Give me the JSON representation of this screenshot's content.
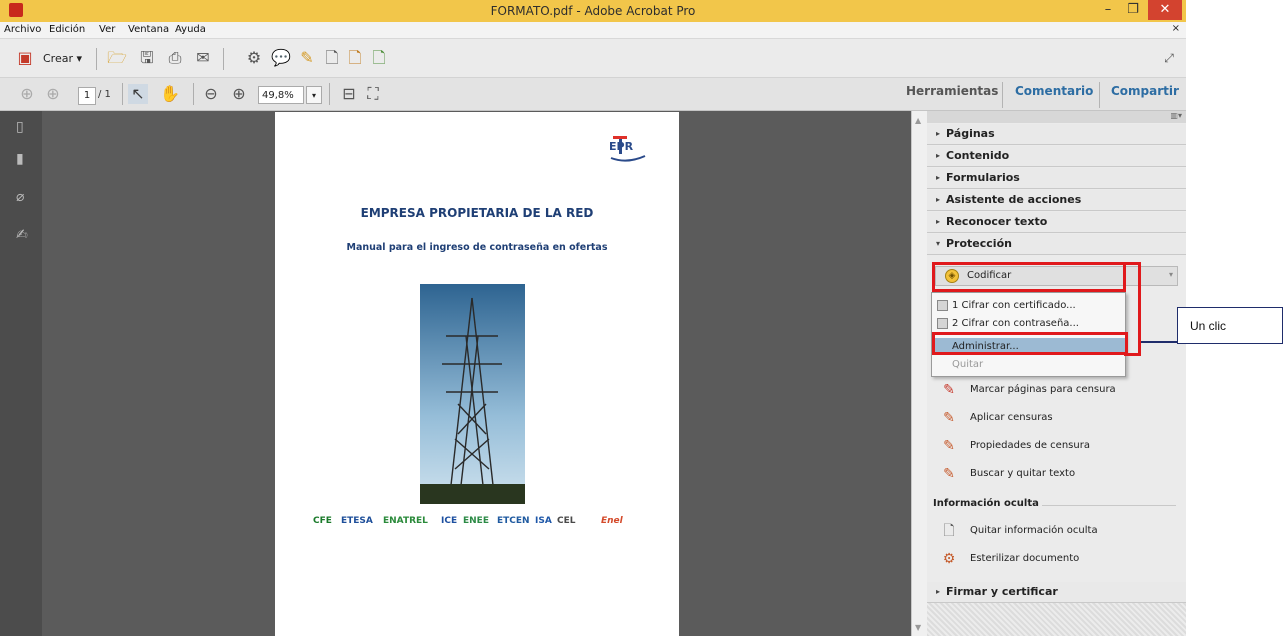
{
  "window": {
    "title": "FORMATO.pdf - Adobe Acrobat Pro",
    "controls": {
      "minimize": "–",
      "maximize": "❐",
      "close": "✕"
    }
  },
  "menubar": {
    "items": [
      "Archivo",
      "Edición",
      "Ver",
      "Ventana",
      "Ayuda"
    ],
    "close_doc": "×"
  },
  "toolbar": {
    "create_label": "Crear",
    "create_arrow": "▾"
  },
  "navigation": {
    "current_page": "1",
    "total_pages": "/ 1",
    "zoom": "49,8%",
    "zoom_arrow": "▾"
  },
  "top_tabs": [
    "Herramientas",
    "Comentario",
    "Compartir"
  ],
  "document": {
    "heading": "EMPRESA PROPIETARIA DE LA RED",
    "subheading": "Manual para el ingreso de contraseña en ofertas",
    "logo_text": "EPR",
    "partner_logos": [
      "CFE",
      "ETESA",
      "ENATREL",
      "ICE",
      "ENEE",
      "ETCEN",
      "ISA",
      "CEL",
      "Enel"
    ]
  },
  "panel": {
    "sections": [
      {
        "label": "Páginas",
        "arrow": "▸"
      },
      {
        "label": "Contenido",
        "arrow": "▸"
      },
      {
        "label": "Formularios",
        "arrow": "▸"
      },
      {
        "label": "Asistente de acciones",
        "arrow": "▸"
      },
      {
        "label": "Reconocer texto",
        "arrow": "▸"
      }
    ],
    "protection": {
      "label": "Protección",
      "arrow": "▾"
    },
    "codificar": {
      "label": "Codificar",
      "arrow": "▾"
    },
    "dropdown": [
      {
        "label": "1 Cifrar con certificado..."
      },
      {
        "label": "2 Cifrar con contraseña..."
      },
      {
        "label": "Administrar..."
      },
      {
        "label": "Quitar"
      }
    ],
    "censura_items": [
      {
        "label": "Marcar páginas para censura",
        "icon": "marker-icon"
      },
      {
        "label": "Aplicar censuras",
        "icon": "apply-redaction-icon"
      },
      {
        "label": "Propiedades de censura",
        "icon": "redaction-properties-icon"
      },
      {
        "label": "Buscar y quitar texto",
        "icon": "search-remove-icon"
      }
    ],
    "hidden_info_header": "Información oculta",
    "hidden_info_items": [
      {
        "label": "Quitar información oculta",
        "icon": "remove-hidden-icon"
      },
      {
        "label": "Esterilizar documento",
        "icon": "sanitize-icon"
      }
    ],
    "firmar": {
      "label": "Firmar y certificar",
      "arrow": "▸"
    }
  },
  "callout": {
    "text": "Un clic"
  },
  "colors": {
    "title_bar": "#f2c64a",
    "callout_box": "#e0191c",
    "link_tabs": "#2d6da3"
  }
}
